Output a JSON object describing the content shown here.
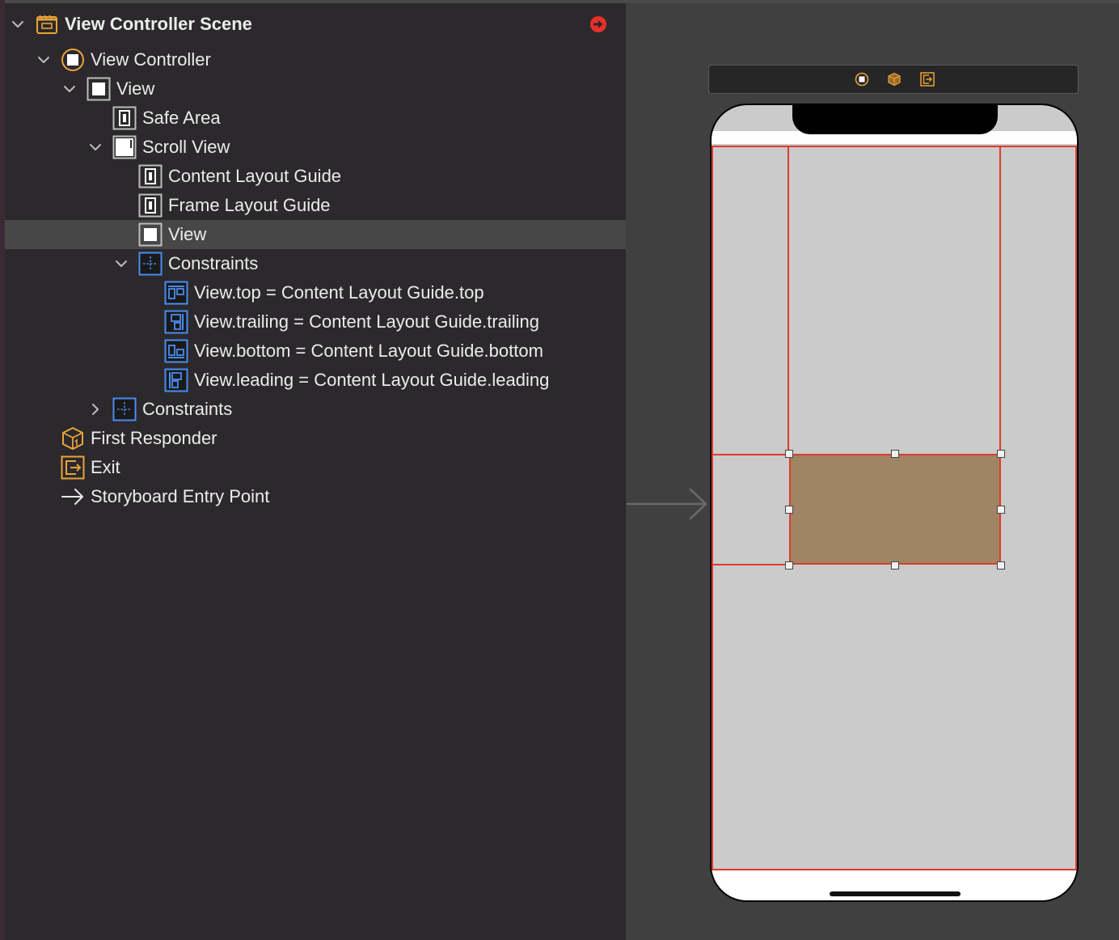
{
  "colors": {
    "outline_bg": "#2c292c",
    "canvas_bg": "#404040",
    "selection_bg": "#474747",
    "accent_orange": "#e8a33a",
    "constraint_blue": "#4a8cf0",
    "constraint_red": "#e0392e",
    "content_view_fill": "#9f8563",
    "error_badge": "#e8302a"
  },
  "outline": {
    "scene": {
      "label": "View Controller Scene",
      "icon": "storyboard-scene-icon",
      "expanded": true,
      "badge": "error-arrow-icon"
    },
    "view_controller": {
      "label": "View Controller",
      "icon": "view-controller-icon",
      "expanded": true
    },
    "root_view": {
      "label": "View",
      "icon": "view-icon",
      "expanded": true
    },
    "safe_area": {
      "label": "Safe Area",
      "icon": "layout-guide-icon"
    },
    "scroll_view": {
      "label": "Scroll View",
      "icon": "scroll-view-icon",
      "expanded": true
    },
    "content_layout_guide": {
      "label": "Content Layout Guide",
      "icon": "layout-guide-icon"
    },
    "frame_layout_guide": {
      "label": "Frame Layout Guide",
      "icon": "layout-guide-icon"
    },
    "content_view": {
      "label": "View",
      "icon": "view-icon",
      "selected": true
    },
    "inner_constraints": {
      "label": "Constraints",
      "icon": "constraints-icon",
      "expanded": true,
      "items": [
        {
          "label": "View.top = Content Layout Guide.top",
          "icon": "constraint-top-icon"
        },
        {
          "label": "View.trailing = Content Layout Guide.trailing",
          "icon": "constraint-trailing-icon"
        },
        {
          "label": "View.bottom = Content Layout Guide.bottom",
          "icon": "constraint-bottom-icon"
        },
        {
          "label": "View.leading = Content Layout Guide.leading",
          "icon": "constraint-leading-icon"
        }
      ]
    },
    "outer_constraints": {
      "label": "Constraints",
      "icon": "constraints-icon",
      "expanded": false
    },
    "first_responder": {
      "label": "First Responder",
      "icon": "first-responder-icon"
    },
    "exit": {
      "label": "Exit",
      "icon": "exit-icon"
    },
    "entry_point": {
      "label": "Storyboard Entry Point",
      "icon": "entry-point-arrow-icon"
    }
  },
  "canvas": {
    "scene_dock": [
      "view-controller-icon",
      "first-responder-icon",
      "exit-icon"
    ],
    "device": "iPhone with notch"
  }
}
